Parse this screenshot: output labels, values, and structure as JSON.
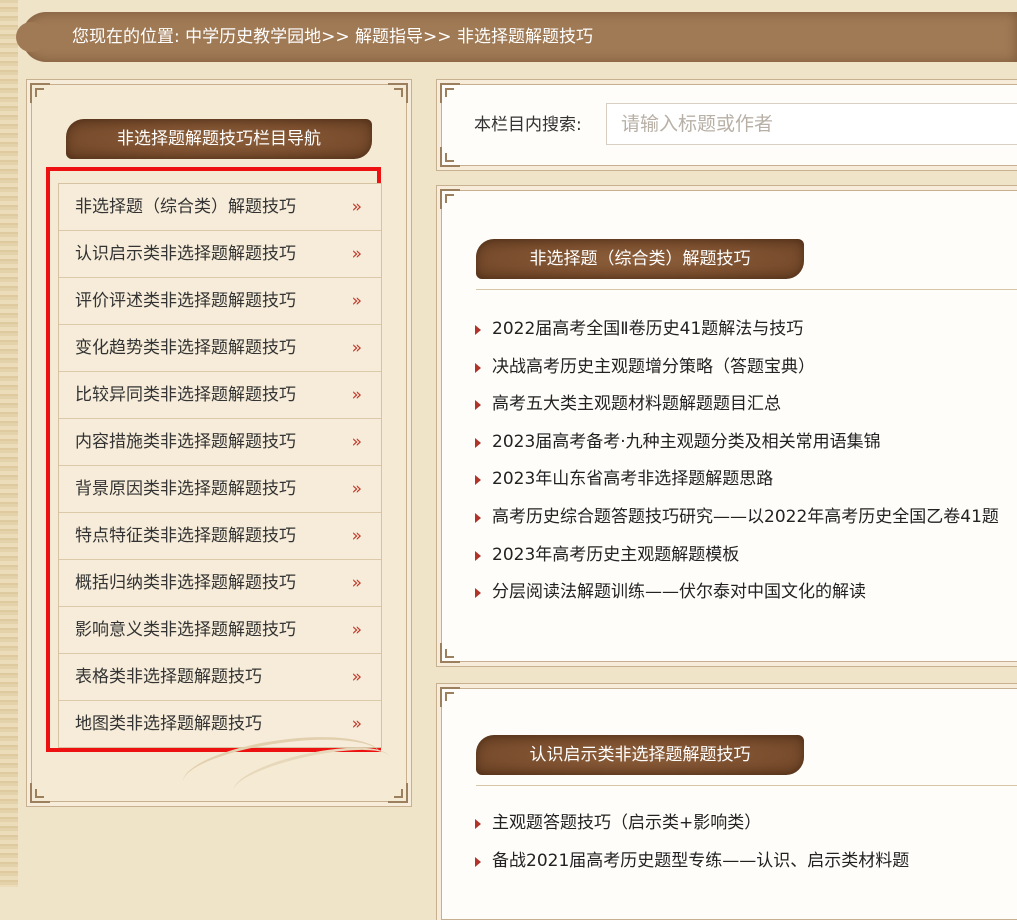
{
  "breadcrumb": {
    "prefix": "您现在的位置:",
    "items": [
      "中学历史教学园地",
      "解题指导",
      "非选择题解题技巧"
    ],
    "separator": ">>"
  },
  "sidebar": {
    "title": "非选择题解题技巧栏目导航",
    "items": [
      "非选择题（综合类）解题技巧",
      "认识启示类非选择题解题技巧",
      "评价评述类非选择题解题技巧",
      "变化趋势类非选择题解题技巧",
      "比较异同类非选择题解题技巧",
      "内容措施类非选择题解题技巧",
      "背景原因类非选择题解题技巧",
      "特点特征类非选择题解题技巧",
      "概括归纳类非选择题解题技巧",
      "影响意义类非选择题解题技巧",
      "表格类非选择题解题技巧",
      "地图类非选择题解题技巧"
    ],
    "arrow": "»"
  },
  "search": {
    "label": "本栏目内搜索:",
    "placeholder": "请输入标题或作者"
  },
  "sections": [
    {
      "title": "非选择题（综合类）解题技巧",
      "articles": [
        "2022届高考全国Ⅱ卷历史41题解法与技巧",
        "决战高考历史主观题增分策略（答题宝典）",
        "高考五大类主观题材料题解题题目汇总",
        "2023届高考备考·九种主观题分类及相关常用语集锦",
        "2023年山东省高考非选择题解题思路",
        "高考历史综合题答题技巧研究——以2022年高考历史全国乙卷41题",
        "2023年高考历史主观题解题模板",
        "分层阅读法解题训练——伏尔泰对中国文化的解读"
      ]
    },
    {
      "title": "认识启示类非选择题解题技巧",
      "articles": [
        "主观题答题技巧（启示类+影响类）",
        "备战2021届高考历史题型专练——认识、启示类材料题"
      ]
    }
  ],
  "colors": {
    "accent": "#7a4e2e",
    "highlight": "#ee1111",
    "bullet": "#b0342a"
  }
}
